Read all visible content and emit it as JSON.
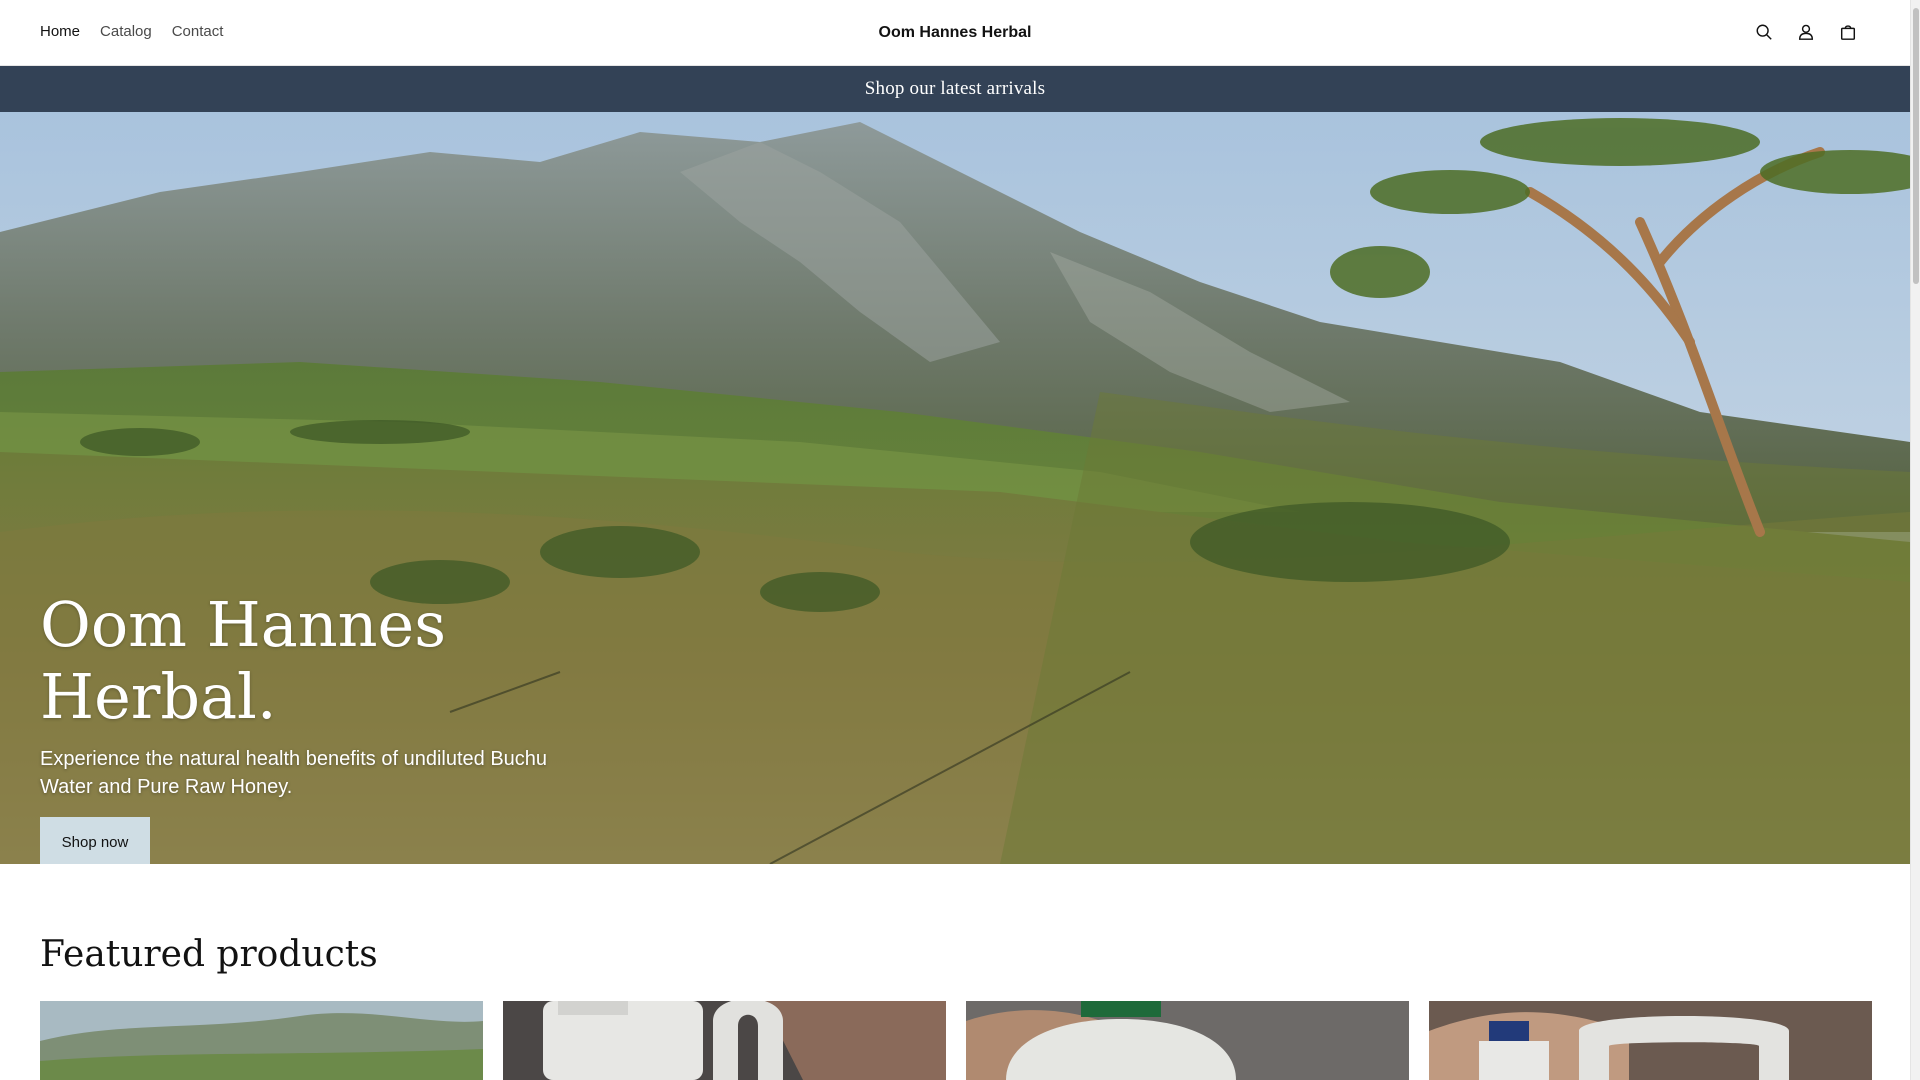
{
  "header": {
    "nav": [
      "Home",
      "Catalog",
      "Contact"
    ],
    "brand": "Oom Hannes Herbal",
    "icons": [
      "search-icon",
      "account-icon",
      "cart-icon"
    ]
  },
  "announcement": "Shop our latest arrivals",
  "hero": {
    "title": "Oom Hannes Herbal.",
    "text": "Experience the natural health benefits of undiluted Buchu Water and Pure Raw Honey.",
    "button": "Shop now",
    "image": "mountain-landscape"
  },
  "featured": {
    "title": "Featured products",
    "products": [
      {
        "image": "landscape-product-image"
      },
      {
        "image": "white-jug-product-image"
      },
      {
        "image": "green-cap-bottle-product-image"
      },
      {
        "image": "blue-cap-jug-product-image"
      }
    ]
  },
  "colors": {
    "announcement_bg": "#334256",
    "button_bg": "#cfdde4",
    "text": "#121212"
  }
}
